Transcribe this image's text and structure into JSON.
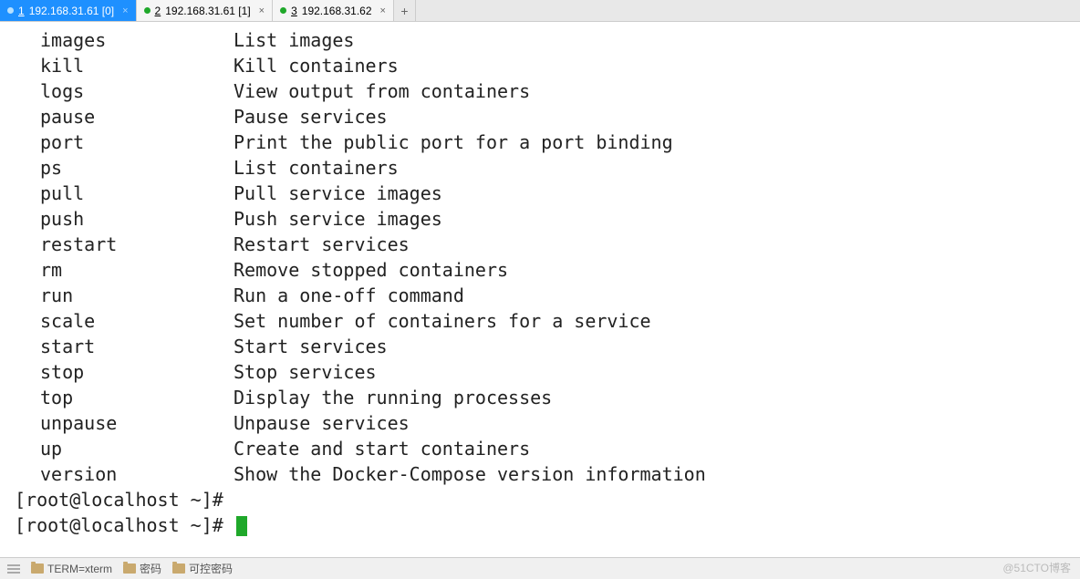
{
  "tabs": [
    {
      "num": "1",
      "label": "192.168.31.61 [0]",
      "active": true
    },
    {
      "num": "2",
      "label": "192.168.31.61 [1]",
      "active": false
    },
    {
      "num": "3",
      "label": "192.168.31.62",
      "active": false
    }
  ],
  "addTab": "+",
  "commands": [
    {
      "name": "images",
      "desc": "List images"
    },
    {
      "name": "kill",
      "desc": "Kill containers"
    },
    {
      "name": "logs",
      "desc": "View output from containers"
    },
    {
      "name": "pause",
      "desc": "Pause services"
    },
    {
      "name": "port",
      "desc": "Print the public port for a port binding"
    },
    {
      "name": "ps",
      "desc": "List containers"
    },
    {
      "name": "pull",
      "desc": "Pull service images"
    },
    {
      "name": "push",
      "desc": "Push service images"
    },
    {
      "name": "restart",
      "desc": "Restart services"
    },
    {
      "name": "rm",
      "desc": "Remove stopped containers"
    },
    {
      "name": "run",
      "desc": "Run a one-off command"
    },
    {
      "name": "scale",
      "desc": "Set number of containers for a service"
    },
    {
      "name": "start",
      "desc": "Start services"
    },
    {
      "name": "stop",
      "desc": "Stop services"
    },
    {
      "name": "top",
      "desc": "Display the running processes"
    },
    {
      "name": "unpause",
      "desc": "Unpause services"
    },
    {
      "name": "up",
      "desc": "Create and start containers"
    },
    {
      "name": "version",
      "desc": "Show the Docker-Compose version information"
    }
  ],
  "prompt1": "[root@localhost ~]#",
  "prompt2": "[root@localhost ~]# ",
  "status": {
    "term": "TERM=xterm",
    "pw": "密码",
    "ctrlpw": "可控密码"
  },
  "watermark": "@51CTO博客"
}
